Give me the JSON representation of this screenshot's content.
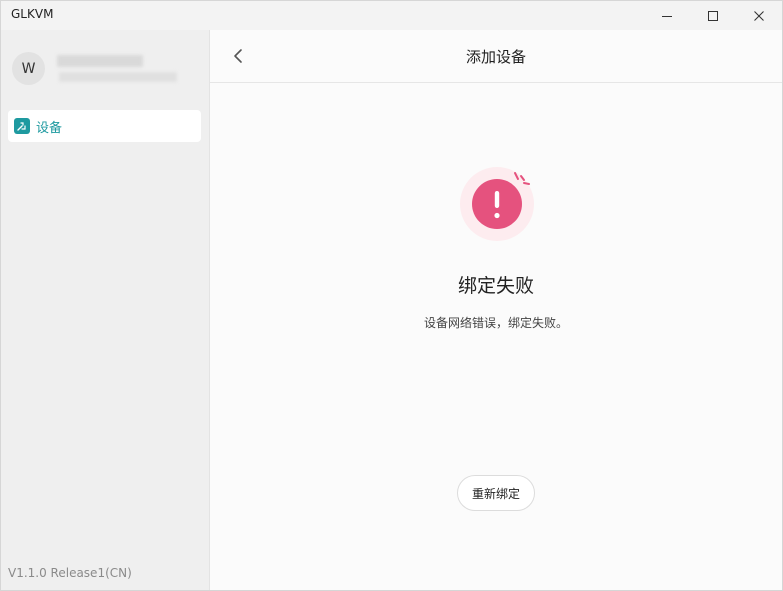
{
  "window": {
    "title": "GLKVM"
  },
  "sidebar": {
    "avatar_initial": "W",
    "items": [
      {
        "label": "设备",
        "icon": "remote-device-icon"
      }
    ],
    "version": "V1.1.0 Release1(CN)"
  },
  "main": {
    "header": {
      "title": "添加设备",
      "back_icon": "chevron-left-icon"
    },
    "status": {
      "icon": "error-exclamation-icon",
      "title": "绑定失败",
      "message": "设备网络错误，绑定失败。"
    },
    "rebind_label": "重新绑定"
  },
  "colors": {
    "accent": "#1e9aa0",
    "error": "#e5527e",
    "error_bg": "#fdecef"
  }
}
